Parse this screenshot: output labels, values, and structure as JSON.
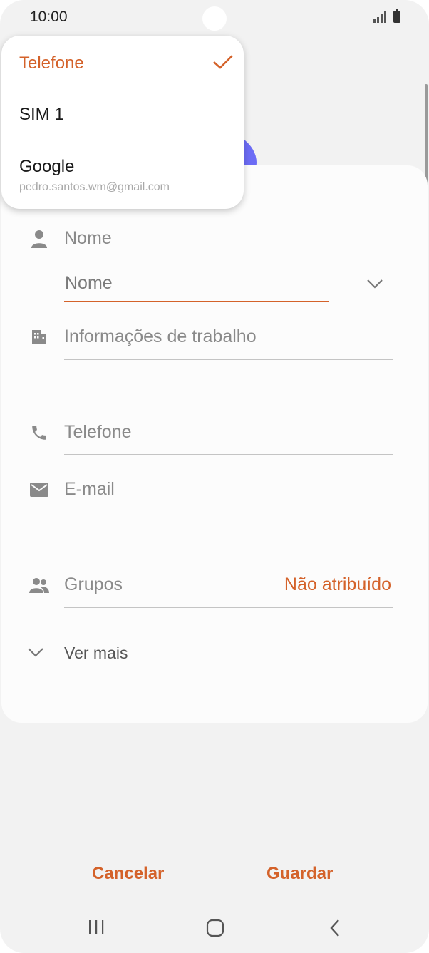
{
  "status_bar": {
    "time": "10:00"
  },
  "popup": {
    "items": [
      {
        "label": "Telefone",
        "selected": true
      },
      {
        "label": "SIM 1",
        "selected": false
      },
      {
        "label": "Google",
        "sublabel": "pedro.santos.wm@gmail.com",
        "selected": false
      }
    ]
  },
  "form": {
    "name_section_label": "Nome",
    "name_input_placeholder": "Nome",
    "work_info_label": "Informações de trabalho",
    "phone_label": "Telefone",
    "email_label": "E-mail",
    "groups_label": "Grupos",
    "groups_value": "Não atribuído",
    "see_more_label": "Ver mais"
  },
  "actions": {
    "cancel_label": "Cancelar",
    "save_label": "Guardar"
  },
  "icons": {
    "person": "person-icon",
    "building": "building-icon",
    "phone": "phone-icon",
    "email": "envelope-icon",
    "groups": "people-icon",
    "check": "checkmark-icon",
    "chevron": "chevron-down-icon"
  },
  "colors": {
    "accent": "#d4622a",
    "avatar": "#6c6cf5"
  }
}
